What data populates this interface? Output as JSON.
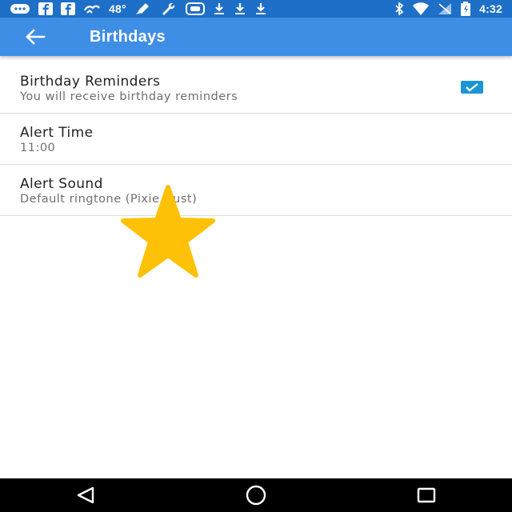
{
  "status_bar": {
    "temperature": "48°",
    "time": "4:32",
    "left_icons": [
      "message-icon",
      "facebook-icon",
      "facebook-icon",
      "weather-icon"
    ],
    "right_icons": [
      "bluetooth-icon",
      "wifi-icon",
      "signal-icon",
      "battery-icon"
    ]
  },
  "app_bar": {
    "title": "Birthdays",
    "back_icon": "arrow-back-icon"
  },
  "settings": [
    {
      "title": "Birthday Reminders",
      "subtitle": "You will receive birthday reminders",
      "checked": true
    },
    {
      "title": "Alert Time",
      "subtitle": "11:00"
    },
    {
      "title": "Alert Sound",
      "subtitle": "Default ringtone (Pixie Dust)"
    }
  ],
  "overlay": {
    "icon": "star-icon",
    "color": "#FFC107"
  },
  "colors": {
    "status_bar": "#1e6fc7",
    "app_bar": "#3f8ee6",
    "checkbox": "#1a96d4",
    "nav_bar": "#000000"
  },
  "nav_bar": {
    "buttons": [
      "back-triangle-icon",
      "home-circle-icon",
      "recents-square-icon"
    ]
  }
}
